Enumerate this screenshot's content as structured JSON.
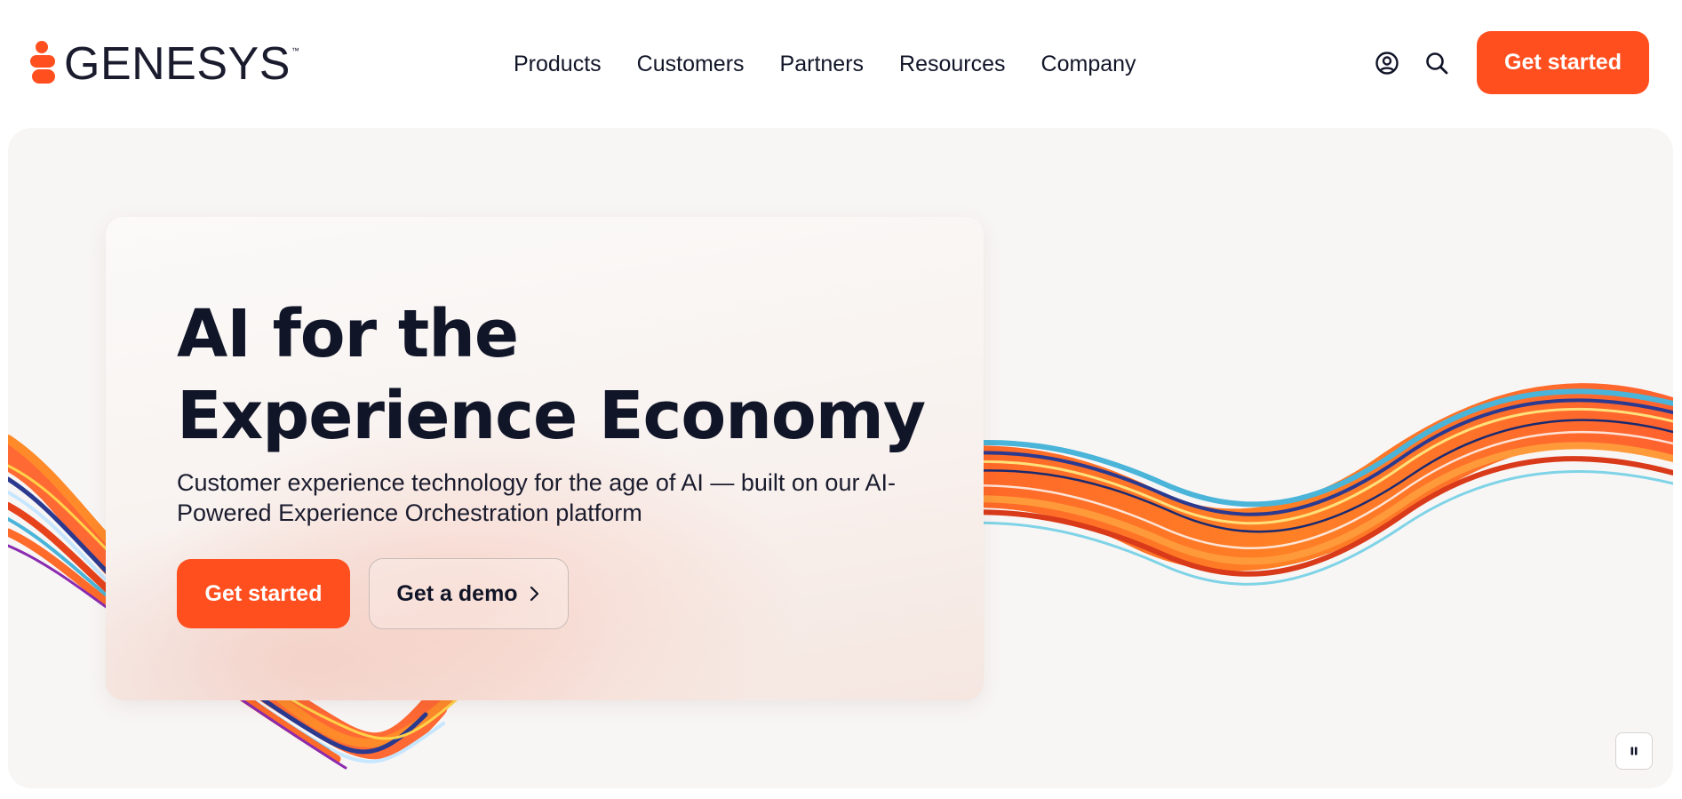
{
  "brand": {
    "name": "GENESYS",
    "trademark": "™",
    "accent_color": "#ff4f1f",
    "text_color": "#111528"
  },
  "header": {
    "nav": [
      {
        "label": "Products"
      },
      {
        "label": "Customers"
      },
      {
        "label": "Partners"
      },
      {
        "label": "Resources"
      },
      {
        "label": "Company"
      }
    ],
    "icons": [
      "account-icon",
      "search-icon"
    ],
    "cta_label": "Get started"
  },
  "hero": {
    "title_line1": "AI for the",
    "title_line2": "Experience Economy",
    "subtitle": "Customer experience technology for the age of AI — built on our AI-Powered Experience Orchestration platform",
    "primary_cta": "Get started",
    "secondary_cta": "Get a demo",
    "secondary_cta_icon": "chevron-right-icon",
    "media_control_icon": "pause-icon",
    "background_color": "#f8f6f5"
  }
}
